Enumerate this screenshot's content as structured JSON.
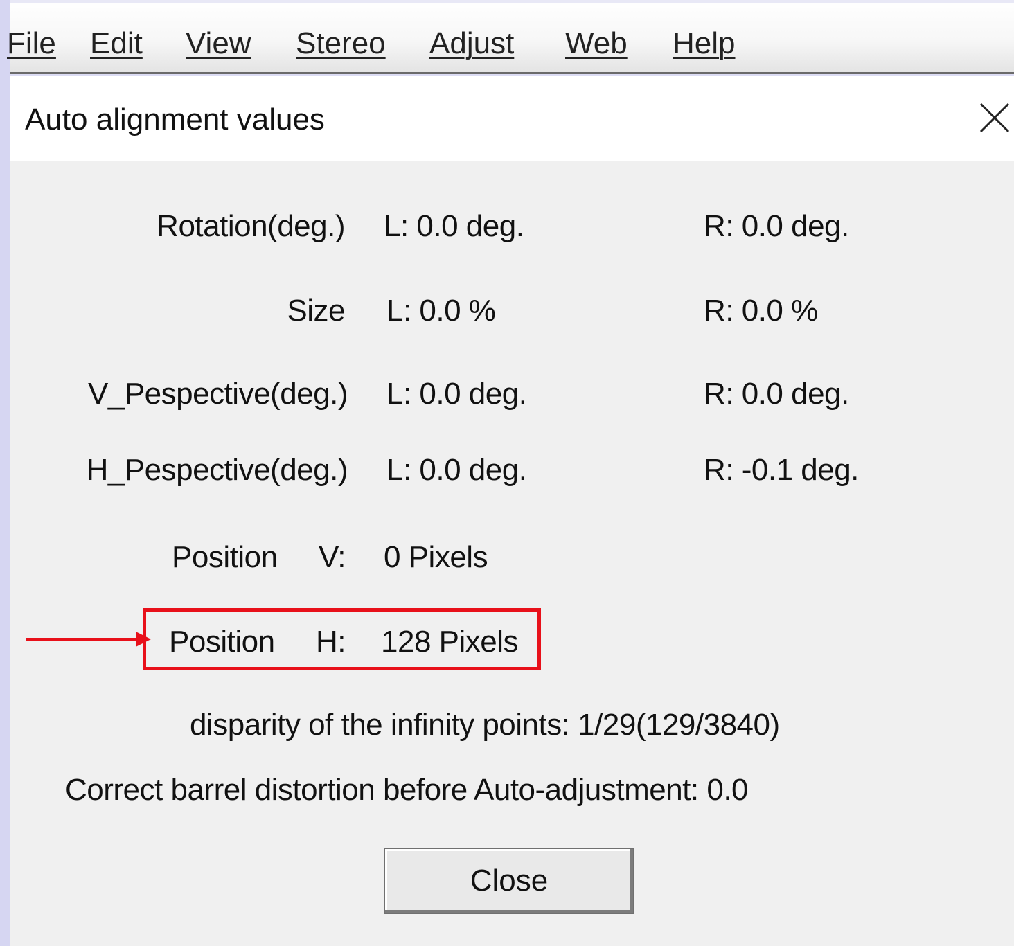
{
  "menu": {
    "items": [
      "File",
      "Edit",
      "View",
      "Stereo",
      "Adjust",
      "Web",
      "Help"
    ]
  },
  "dialog": {
    "title": "Auto alignment values",
    "rows": [
      {
        "label": "Rotation(deg.)",
        "left": "L:  0.0 deg.",
        "right": "R:  0.0 deg."
      },
      {
        "label": "Size",
        "left": "L:  0.0 %",
        "right": "R:  0.0 %"
      },
      {
        "label": "V_Pespective(deg.)",
        "left": "L:  0.0 deg.",
        "right": "R:  0.0 deg."
      },
      {
        "label": "H_Pespective(deg.)",
        "left": "L:  0.0 deg.",
        "right": "R:  -0.1 deg."
      }
    ],
    "position_v": {
      "label": "Position",
      "axis": "V:",
      "value": "0 Pixels"
    },
    "position_h": {
      "label": "Position",
      "axis": "H:",
      "value": "128 Pixels"
    },
    "disparity": "disparity of the infinity points: 1/29(129/3840)",
    "barrel": "Correct barrel distortion before Auto-adjustment: 0.0",
    "close_label": "Close"
  },
  "colors": {
    "highlight": "#e8101a",
    "dialog_bg": "#f0f0f0"
  }
}
